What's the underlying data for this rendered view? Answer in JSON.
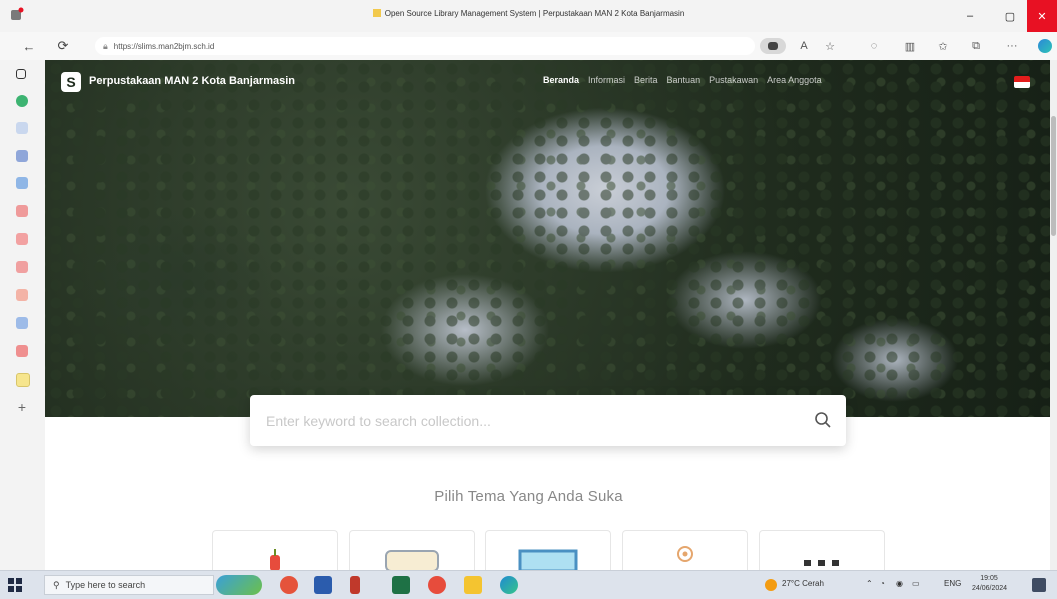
{
  "window": {
    "title": "Open Source Library Management System | Perpustakaan MAN 2 Kota Banjarmasin",
    "minimize": "–",
    "maximize": "▢",
    "close": "✕"
  },
  "browser": {
    "url": "https://slims.man2bjm.sch.id",
    "back_icon": "←",
    "refresh_icon": "⟳",
    "more_icon": "···"
  },
  "site": {
    "logo_letter": "S",
    "title": "Perpustakaan MAN 2 Kota Banjarmasin",
    "nav": [
      "Beranda",
      "Informasi",
      "Berita",
      "Bantuan",
      "Pustakawan",
      "Area Anggota"
    ]
  },
  "search": {
    "placeholder": "Enter keyword to search collection..."
  },
  "themes": {
    "heading": "Pilih Tema Yang Anda Suka",
    "cards": [
      "card-1",
      "card-2",
      "card-3",
      "card-4",
      "card-5"
    ]
  },
  "taskbar": {
    "search_placeholder": "Type here to search",
    "weather": "27°C Cerah",
    "language": "ENG",
    "time": "19:05",
    "date": "24/06/2024"
  },
  "colors": {
    "window_close": "#e81123",
    "flag_red": "#e31d1c",
    "copilot": "#2b88d8"
  }
}
